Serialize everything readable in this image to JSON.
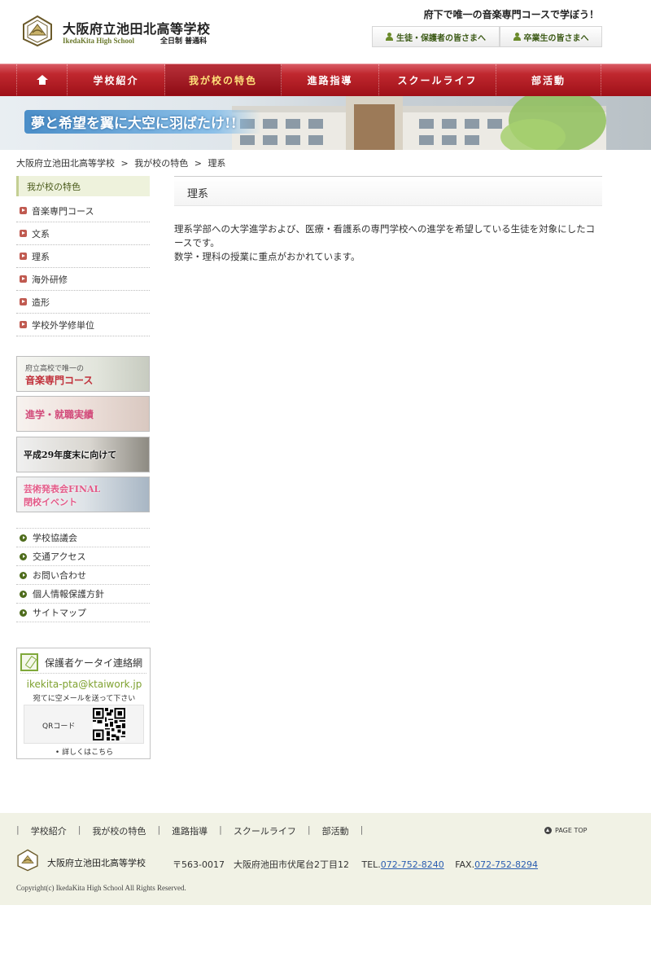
{
  "header": {
    "school_name": "大阪府立池田北高等学校",
    "school_name_en": "IkedaKita High School",
    "school_type": "全日制 普通科",
    "catchphrase": "府下で唯一の音楽専門コースで学ぼう！",
    "buttons": [
      "生徒・保護者の皆さまへ",
      "卒業生の皆さまへ"
    ]
  },
  "nav": {
    "home_icon": "home-icon",
    "items": [
      "学校紹介",
      "我が校の特色",
      "進路指導",
      "スクールライフ",
      "部活動"
    ],
    "active": "我が校の特色"
  },
  "banner": {
    "text": "夢と希望を翼に大空に羽ばたけ!!"
  },
  "breadcrumb": [
    "大阪府立池田北高等学校",
    ">",
    "我が校の特色",
    ">",
    "理系"
  ],
  "sidebar": {
    "title": "我が校の特色",
    "links": [
      "音楽専門コース",
      "文系",
      "理系",
      "海外研修",
      "造形",
      "学校外学修単位"
    ],
    "banners": {
      "music_small": "府立高校で唯一の",
      "music_large": "音楽専門コース",
      "career": "進学・就職実績",
      "h29": "平成29年度末に向けて",
      "art_line1": "芸術発表会FINAL",
      "art_line2": "閉校イベント"
    },
    "sub_links": [
      "学校協議会",
      "交通アクセス",
      "お問い合わせ",
      "個人情報保護方針",
      "サイトマップ"
    ],
    "pta": {
      "title": "保護者ケータイ連絡網",
      "email": "ikekita-pta@ktaiwork.jp",
      "note": "宛てに空メールを送って下さい",
      "qr_label": "QRコード",
      "more": "• 詳しくはこちら"
    }
  },
  "main": {
    "title": "理系",
    "paragraph1": "理系学部への大学進学および、医療・看護系の専門学校への進学を希望している生徒を対象にしたコースです。",
    "paragraph2": "数学・理科の授業に重点がおかれています。"
  },
  "footer": {
    "links": [
      "学校紹介",
      "我が校の特色",
      "進路指導",
      "スクールライフ",
      "部活動"
    ],
    "separator": "|",
    "page_top": "PAGE TOP",
    "school_name": "大阪府立池田北高等学校",
    "address": "〒563-0017　大阪府池田市伏尾台2丁目12",
    "tel_label": "TEL.",
    "tel": "072-752-8240",
    "fax_label": "FAX.",
    "fax": "072-752-8294",
    "copyright": "Copyright(c) IkedaKita High School All Rights Reserved."
  },
  "colors": {
    "nav_red": "#c0282f",
    "accent_green": "#7ea12f",
    "active_nav_text": "#ffe27a"
  }
}
